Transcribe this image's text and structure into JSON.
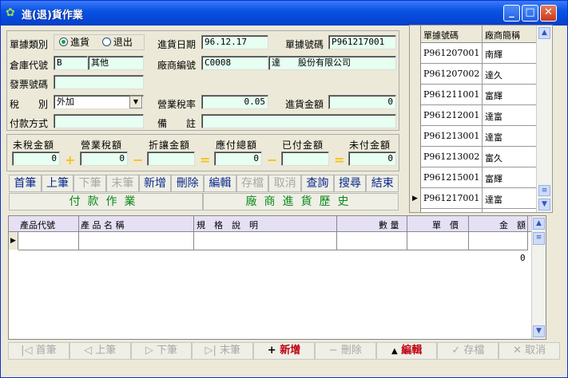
{
  "window": {
    "title": "進(退)貨作業",
    "min": "_",
    "max": "□",
    "close": "✕"
  },
  "form": {
    "doc_type_label": "單據類別",
    "radio_in": "進貨",
    "radio_out": "退出",
    "date_label": "進貨日期",
    "date_value": "96.12.17",
    "doc_no_label": "單據號碼",
    "doc_no_value": "P961217001",
    "warehouse_label": "倉庫代號",
    "warehouse_code": "B",
    "warehouse_name": "其他",
    "vendor_label": "廠商編號",
    "vendor_code": "C0008",
    "vendor_name": "達",
    "vendor_company": "股份有限公司",
    "invoice_label": "發票號碼",
    "invoice_value": "",
    "tax_label": "稅　　別",
    "tax_value": "外加",
    "tax_rate_label": "營業稅率",
    "tax_rate_value": "0.05",
    "amount_label": "進貨金額",
    "amount_value": "0",
    "pay_label": "付款方式",
    "pay_value": "",
    "note_label": "備　　註",
    "note_value": ""
  },
  "summary": {
    "labels": [
      "未稅金額",
      "營業稅額",
      "折讓金額",
      "應付總額",
      "已付金額",
      "未付金額"
    ],
    "values": [
      "0",
      "0",
      "",
      "0",
      "",
      "0"
    ],
    "ops": [
      "+",
      "−",
      "=",
      "−",
      "="
    ]
  },
  "toolbar": {
    "items": [
      {
        "label": "首筆",
        "enabled": true
      },
      {
        "label": "上筆",
        "enabled": true
      },
      {
        "label": "下筆",
        "enabled": false
      },
      {
        "label": "末筆",
        "enabled": false
      },
      {
        "label": "新增",
        "enabled": true
      },
      {
        "label": "刪除",
        "enabled": true
      },
      {
        "label": "編輯",
        "enabled": true
      },
      {
        "label": "存檔",
        "enabled": false
      },
      {
        "label": "取消",
        "enabled": false
      },
      {
        "label": "查詢",
        "enabled": true
      },
      {
        "label": "搜尋",
        "enabled": true
      },
      {
        "label": "結束",
        "enabled": true
      }
    ],
    "payment_banner": "付款作業",
    "history_banner": "廠商進貨歷史"
  },
  "doclist": {
    "headers": [
      "單據號碼",
      "廠商簡稱"
    ],
    "rows": [
      [
        "P961207001",
        "南輝"
      ],
      [
        "P961207002",
        "達久"
      ],
      [
        "P961211001",
        "富輝"
      ],
      [
        "P961212001",
        "達富"
      ],
      [
        "P961213001",
        "達富"
      ],
      [
        "P961213002",
        "富久"
      ],
      [
        "P961215001",
        "富輝"
      ],
      [
        "P961217001",
        "達富"
      ]
    ]
  },
  "detail": {
    "headers": [
      "產品代號",
      "產 品 名 稱",
      "規　格　說　明",
      "數 量",
      "單　價",
      "金　額"
    ],
    "total": "0"
  },
  "bottombar": {
    "items": [
      {
        "icon": "|◁",
        "label": "首筆",
        "state": "disabled"
      },
      {
        "icon": "◁",
        "label": "上筆",
        "state": "disabled"
      },
      {
        "icon": "▷",
        "label": "下筆",
        "state": "disabled"
      },
      {
        "icon": "▷|",
        "label": "末筆",
        "state": "disabled"
      },
      {
        "icon": "+",
        "label": "新增",
        "state": "active"
      },
      {
        "icon": "−",
        "label": "刪除",
        "state": "disabled"
      },
      {
        "icon": "▲",
        "label": "編輯",
        "state": "active"
      },
      {
        "icon": "✓",
        "label": "存檔",
        "state": "disabled"
      },
      {
        "icon": "✕",
        "label": "取消",
        "state": "disabled"
      }
    ]
  }
}
